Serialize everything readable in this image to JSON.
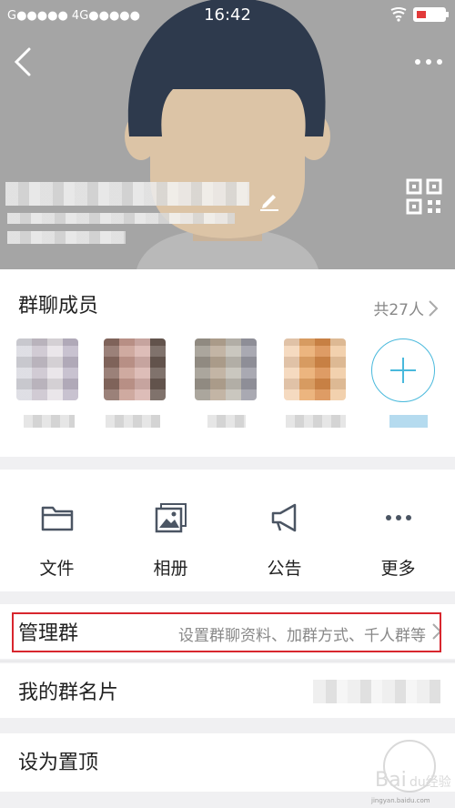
{
  "status": {
    "carrier_left": "G●●●●● 4G●●●●●",
    "time": "16:42"
  },
  "members": {
    "title": "群聊成员",
    "count_label": "共27人"
  },
  "functions": [
    {
      "label": "文件",
      "icon": "folder-icon"
    },
    {
      "label": "相册",
      "icon": "photo-album-icon"
    },
    {
      "label": "公告",
      "icon": "megaphone-icon"
    },
    {
      "label": "更多",
      "icon": "more-dots-icon"
    }
  ],
  "rows": {
    "manage": {
      "title": "管理群",
      "subtitle": "设置群聊资料、加群方式、千人群等"
    },
    "my_card": {
      "title": "我的群名片"
    },
    "pin_top": {
      "title": "设为置顶"
    }
  },
  "watermark": {
    "text": "jingyan.baidu.com"
  },
  "colors": {
    "accent": "#49b9dc",
    "highlight_border": "#d8262e",
    "hero_bg": "#a5a5a5",
    "avatar_hair": "#2e3a4d",
    "avatar_skin": "#dcc4a6"
  }
}
